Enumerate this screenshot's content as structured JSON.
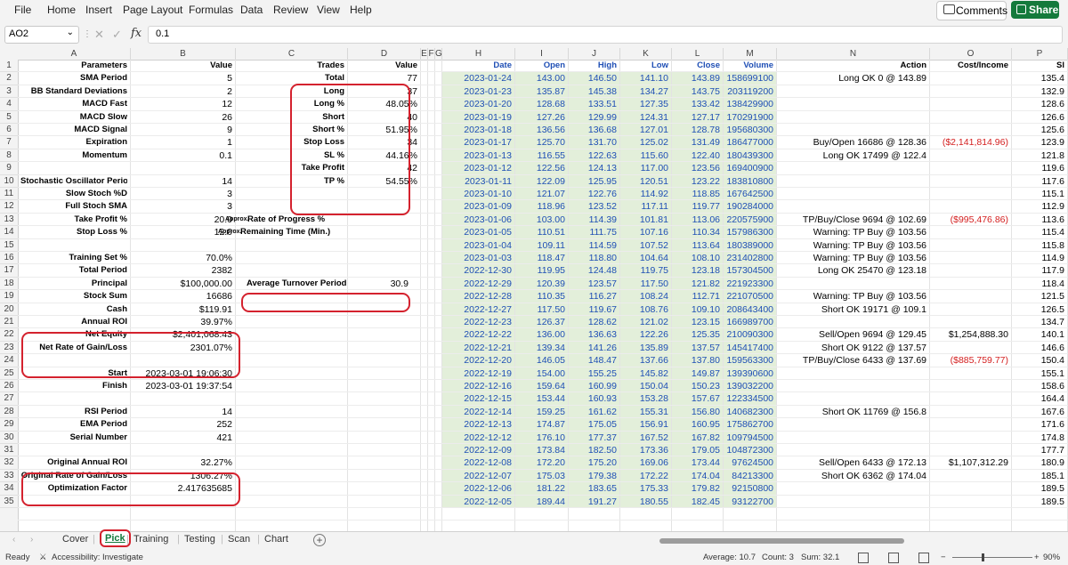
{
  "menu": [
    "File",
    "Home",
    "Insert",
    "Page Layout",
    "Formulas",
    "Data",
    "Review",
    "View",
    "Help"
  ],
  "toolbar": {
    "comments_label": "Comments",
    "share_label": "Share"
  },
  "formula_bar": {
    "cell_ref": "AO2",
    "fx_symbol": "fx",
    "value": "0.1"
  },
  "columns": [
    "A",
    "B",
    "C",
    "D",
    "E",
    "F",
    "G",
    "H",
    "I",
    "J",
    "K",
    "L",
    "M",
    "N",
    "O",
    "P"
  ],
  "rows": [
    "1",
    "2",
    "3",
    "4",
    "5",
    "6",
    "7",
    "8",
    "9",
    "10",
    "11",
    "12",
    "13",
    "14",
    "15",
    "16",
    "17",
    "18",
    "19",
    "20",
    "21",
    "22",
    "23",
    "24",
    "25",
    "26",
    "27",
    "28",
    "29",
    "30",
    "31",
    "32",
    "33",
    "34",
    "35"
  ],
  "headers": {
    "parameters": "Parameters",
    "value_b": "Value",
    "trades": "Trades",
    "value_d": "Value",
    "date": "Date",
    "open": "Open",
    "high": "High",
    "low": "Low",
    "close": "Close",
    "volume": "Volume",
    "action": "Action",
    "cost_income": "Cost/Income",
    "p_partial": "Sl"
  },
  "params": [
    {
      "row": 2,
      "label": "SMA Period",
      "value": "5"
    },
    {
      "row": 3,
      "label": "BB Standard Deviations",
      "value": "2"
    },
    {
      "row": 4,
      "label": "MACD Fast",
      "value": "12"
    },
    {
      "row": 5,
      "label": "MACD Slow",
      "value": "26"
    },
    {
      "row": 6,
      "label": "MACD Signal",
      "value": "9"
    },
    {
      "row": 7,
      "label": "Expiration",
      "value": "1"
    },
    {
      "row": 8,
      "label": "Momentum",
      "value": "0.1"
    },
    {
      "row": 10,
      "label": "Stochastic Oscillator Period",
      "value": "14"
    },
    {
      "row": 11,
      "label": "Slow Stoch %D",
      "value": "3"
    },
    {
      "row": 12,
      "label": "Full Stoch SMA",
      "value": "3"
    },
    {
      "row": 13,
      "label": "Take Profit %",
      "value": "20.0"
    },
    {
      "row": 14,
      "label": "Stop Loss %",
      "value": "12.0"
    },
    {
      "row": 16,
      "label": "Training Set %",
      "value": "70.0%"
    },
    {
      "row": 17,
      "label": "Total Period",
      "value": "2382"
    },
    {
      "row": 18,
      "label": "Principal",
      "value": "$100,000.00"
    },
    {
      "row": 19,
      "label": "Stock Sum",
      "value": "16686"
    },
    {
      "row": 20,
      "label": "Cash",
      "value": "$119.91"
    },
    {
      "row": 21,
      "label": "Annual ROI",
      "value": "39.97%"
    },
    {
      "row": 22,
      "label": "Net Equity",
      "value": "$2,401,068.43"
    },
    {
      "row": 23,
      "label": "Net Rate of Gain/Loss",
      "value": "2301.07%"
    },
    {
      "row": 25,
      "label": "Start",
      "value": "2023-03-01 19:06:30"
    },
    {
      "row": 26,
      "label": "Finish",
      "value": "2023-03-01 19:37:54"
    },
    {
      "row": 28,
      "label": "RSI Period",
      "value": "14"
    },
    {
      "row": 29,
      "label": "EMA Period",
      "value": "252"
    },
    {
      "row": 30,
      "label": "Serial Number",
      "value": "421"
    },
    {
      "row": 32,
      "label": "Original Annual ROI",
      "value": "32.27%"
    },
    {
      "row": 33,
      "label": "Original Rate of Gain/Loss",
      "value": "1306.27%"
    },
    {
      "row": 34,
      "label": "Optimization Factor",
      "value": "2.417635685"
    }
  ],
  "trades": [
    {
      "row": 2,
      "label": "Total",
      "value": "77"
    },
    {
      "row": 3,
      "label": "Long",
      "value": "37"
    },
    {
      "row": 4,
      "label": "Long %",
      "value": "48.05%"
    },
    {
      "row": 5,
      "label": "Short",
      "value": "40"
    },
    {
      "row": 6,
      "label": "Short %",
      "value": "51.95%"
    },
    {
      "row": 7,
      "label": "Stop Loss",
      "value": "34"
    },
    {
      "row": 8,
      "label": "SL %",
      "value": "44.16%"
    },
    {
      "row": 9,
      "label": "Take Profit",
      "value": "42"
    },
    {
      "row": 10,
      "label": "TP %",
      "value": "54.55%"
    }
  ],
  "progress": {
    "approx1": "Approx.",
    "rate_label": "Rate of Progress %",
    "approx2": "Approx.",
    "time_label": "Remaining Time (Min.)"
  },
  "turnover": {
    "label": "Average Turnover Period",
    "value": "30.9"
  },
  "market": [
    {
      "row": 2,
      "date": "2023-01-24",
      "open": "143.00",
      "high": "146.50",
      "low": "141.10",
      "close": "143.89",
      "volume": "158699100",
      "action": "Long OK 0 @ 143.89",
      "cost": "",
      "p": "135.4"
    },
    {
      "row": 3,
      "date": "2023-01-23",
      "open": "135.87",
      "high": "145.38",
      "low": "134.27",
      "close": "143.75",
      "volume": "203119200",
      "action": "",
      "cost": "",
      "p": "132.9"
    },
    {
      "row": 4,
      "date": "2023-01-20",
      "open": "128.68",
      "high": "133.51",
      "low": "127.35",
      "close": "133.42",
      "volume": "138429900",
      "action": "",
      "cost": "",
      "p": "128.6"
    },
    {
      "row": 5,
      "date": "2023-01-19",
      "open": "127.26",
      "high": "129.99",
      "low": "124.31",
      "close": "127.17",
      "volume": "170291900",
      "action": "",
      "cost": "",
      "p": "126.6"
    },
    {
      "row": 6,
      "date": "2023-01-18",
      "open": "136.56",
      "high": "136.68",
      "low": "127.01",
      "close": "128.78",
      "volume": "195680300",
      "action": "",
      "cost": "",
      "p": "125.6"
    },
    {
      "row": 7,
      "date": "2023-01-17",
      "open": "125.70",
      "high": "131.70",
      "low": "125.02",
      "close": "131.49",
      "volume": "186477000",
      "action": "Buy/Open 16686 @ 128.36",
      "cost": "($2,141,814.96)",
      "p": "123.9"
    },
    {
      "row": 8,
      "date": "2023-01-13",
      "open": "116.55",
      "high": "122.63",
      "low": "115.60",
      "close": "122.40",
      "volume": "180439300",
      "action": "Long OK 17499 @ 122.4",
      "cost": "",
      "p": "121.8"
    },
    {
      "row": 9,
      "date": "2023-01-12",
      "open": "122.56",
      "high": "124.13",
      "low": "117.00",
      "close": "123.56",
      "volume": "169400900",
      "action": "",
      "cost": "",
      "p": "119.6"
    },
    {
      "row": 10,
      "date": "2023-01-11",
      "open": "122.09",
      "high": "125.95",
      "low": "120.51",
      "close": "123.22",
      "volume": "183810800",
      "action": "",
      "cost": "",
      "p": "117.6"
    },
    {
      "row": 11,
      "date": "2023-01-10",
      "open": "121.07",
      "high": "122.76",
      "low": "114.92",
      "close": "118.85",
      "volume": "167642500",
      "action": "",
      "cost": "",
      "p": "115.1"
    },
    {
      "row": 12,
      "date": "2023-01-09",
      "open": "118.96",
      "high": "123.52",
      "low": "117.11",
      "close": "119.77",
      "volume": "190284000",
      "action": "",
      "cost": "",
      "p": "112.9"
    },
    {
      "row": 13,
      "date": "2023-01-06",
      "open": "103.00",
      "high": "114.39",
      "low": "101.81",
      "close": "113.06",
      "volume": "220575900",
      "action": "TP/Buy/Close 9694 @ 102.69",
      "cost": "($995,476.86)",
      "p": "113.6"
    },
    {
      "row": 14,
      "date": "2023-01-05",
      "open": "110.51",
      "high": "111.75",
      "low": "107.16",
      "close": "110.34",
      "volume": "157986300",
      "action": "Warning: TP Buy @ 103.56",
      "cost": "",
      "p": "115.4"
    },
    {
      "row": 15,
      "date": "2023-01-04",
      "open": "109.11",
      "high": "114.59",
      "low": "107.52",
      "close": "113.64",
      "volume": "180389000",
      "action": "Warning: TP Buy @ 103.56",
      "cost": "",
      "p": "115.8"
    },
    {
      "row": 16,
      "date": "2023-01-03",
      "open": "118.47",
      "high": "118.80",
      "low": "104.64",
      "close": "108.10",
      "volume": "231402800",
      "action": "Warning: TP Buy @ 103.56",
      "cost": "",
      "p": "114.9"
    },
    {
      "row": 17,
      "date": "2022-12-30",
      "open": "119.95",
      "high": "124.48",
      "low": "119.75",
      "close": "123.18",
      "volume": "157304500",
      "action": "Long OK 25470 @ 123.18",
      "cost": "",
      "p": "117.9"
    },
    {
      "row": 18,
      "date": "2022-12-29",
      "open": "120.39",
      "high": "123.57",
      "low": "117.50",
      "close": "121.82",
      "volume": "221923300",
      "action": "",
      "cost": "",
      "p": "118.4"
    },
    {
      "row": 19,
      "date": "2022-12-28",
      "open": "110.35",
      "high": "116.27",
      "low": "108.24",
      "close": "112.71",
      "volume": "221070500",
      "action": "Warning: TP Buy @ 103.56",
      "cost": "",
      "p": "121.5"
    },
    {
      "row": 20,
      "date": "2022-12-27",
      "open": "117.50",
      "high": "119.67",
      "low": "108.76",
      "close": "109.10",
      "volume": "208643400",
      "action": "Short OK 19171 @ 109.1",
      "cost": "",
      "p": "126.5"
    },
    {
      "row": 21,
      "date": "2022-12-23",
      "open": "126.37",
      "high": "128.62",
      "low": "121.02",
      "close": "123.15",
      "volume": "166989700",
      "action": "",
      "cost": "",
      "p": "134.7"
    },
    {
      "row": 22,
      "date": "2022-12-22",
      "open": "136.00",
      "high": "136.63",
      "low": "122.26",
      "close": "125.35",
      "volume": "210090300",
      "action": "Sell/Open 9694 @ 129.45",
      "cost": "$1,254,888.30",
      "p": "140.1"
    },
    {
      "row": 23,
      "date": "2022-12-21",
      "open": "139.34",
      "high": "141.26",
      "low": "135.89",
      "close": "137.57",
      "volume": "145417400",
      "action": "Short OK 9122 @ 137.57",
      "cost": "",
      "p": "146.6"
    },
    {
      "row": 24,
      "date": "2022-12-20",
      "open": "146.05",
      "high": "148.47",
      "low": "137.66",
      "close": "137.80",
      "volume": "159563300",
      "action": "TP/Buy/Close 6433 @ 137.69",
      "cost": "($885,759.77)",
      "p": "150.4"
    },
    {
      "row": 25,
      "date": "2022-12-19",
      "open": "154.00",
      "high": "155.25",
      "low": "145.82",
      "close": "149.87",
      "volume": "139390600",
      "action": "",
      "cost": "",
      "p": "155.1"
    },
    {
      "row": 26,
      "date": "2022-12-16",
      "open": "159.64",
      "high": "160.99",
      "low": "150.04",
      "close": "150.23",
      "volume": "139032200",
      "action": "",
      "cost": "",
      "p": "158.6"
    },
    {
      "row": 27,
      "date": "2022-12-15",
      "open": "153.44",
      "high": "160.93",
      "low": "153.28",
      "close": "157.67",
      "volume": "122334500",
      "action": "",
      "cost": "",
      "p": "164.4"
    },
    {
      "row": 28,
      "date": "2022-12-14",
      "open": "159.25",
      "high": "161.62",
      "low": "155.31",
      "close": "156.80",
      "volume": "140682300",
      "action": "Short OK 11769 @ 156.8",
      "cost": "",
      "p": "167.6"
    },
    {
      "row": 29,
      "date": "2022-12-13",
      "open": "174.87",
      "high": "175.05",
      "low": "156.91",
      "close": "160.95",
      "volume": "175862700",
      "action": "",
      "cost": "",
      "p": "171.6"
    },
    {
      "row": 30,
      "date": "2022-12-12",
      "open": "176.10",
      "high": "177.37",
      "low": "167.52",
      "close": "167.82",
      "volume": "109794500",
      "action": "",
      "cost": "",
      "p": "174.8"
    },
    {
      "row": 31,
      "date": "2022-12-09",
      "open": "173.84",
      "high": "182.50",
      "low": "173.36",
      "close": "179.05",
      "volume": "104872300",
      "action": "",
      "cost": "",
      "p": "177.7"
    },
    {
      "row": 32,
      "date": "2022-12-08",
      "open": "172.20",
      "high": "175.20",
      "low": "169.06",
      "close": "173.44",
      "volume": "97624500",
      "action": "Sell/Open 6433 @ 172.13",
      "cost": "$1,107,312.29",
      "p": "180.9"
    },
    {
      "row": 33,
      "date": "2022-12-07",
      "open": "175.03",
      "high": "179.38",
      "low": "172.22",
      "close": "174.04",
      "volume": "84213300",
      "action": "Short OK 6362 @ 174.04",
      "cost": "",
      "p": "185.1"
    },
    {
      "row": 34,
      "date": "2022-12-06",
      "open": "181.22",
      "high": "183.65",
      "low": "175.33",
      "close": "179.82",
      "volume": "92150800",
      "action": "",
      "cost": "",
      "p": "189.5"
    },
    {
      "row": 35,
      "date": "2022-12-05",
      "open": "189.44",
      "high": "191.27",
      "low": "180.55",
      "close": "182.45",
      "volume": "93122700",
      "action": "",
      "cost": "",
      "p": "189.5"
    }
  ],
  "tabs": [
    {
      "label": "Cover",
      "active": false
    },
    {
      "label": "Pick",
      "active": true
    },
    {
      "label": "Training",
      "active": false
    },
    {
      "label": "Testing",
      "active": false
    },
    {
      "label": "Scan",
      "active": false
    },
    {
      "label": "Chart",
      "active": false
    }
  ],
  "status": {
    "ready": "Ready",
    "accessibility": "Accessibility: Investigate",
    "average": "Average: 10.7",
    "count": "Count: 3",
    "sum": "Sum: 32.1",
    "zoom": "90%"
  },
  "colors": {
    "accent_green": "#147a3c",
    "highlight_red": "#d4222e",
    "data_blue": "#1f4fb5",
    "band_green": "#e3efda",
    "negative_red": "#d42020"
  }
}
